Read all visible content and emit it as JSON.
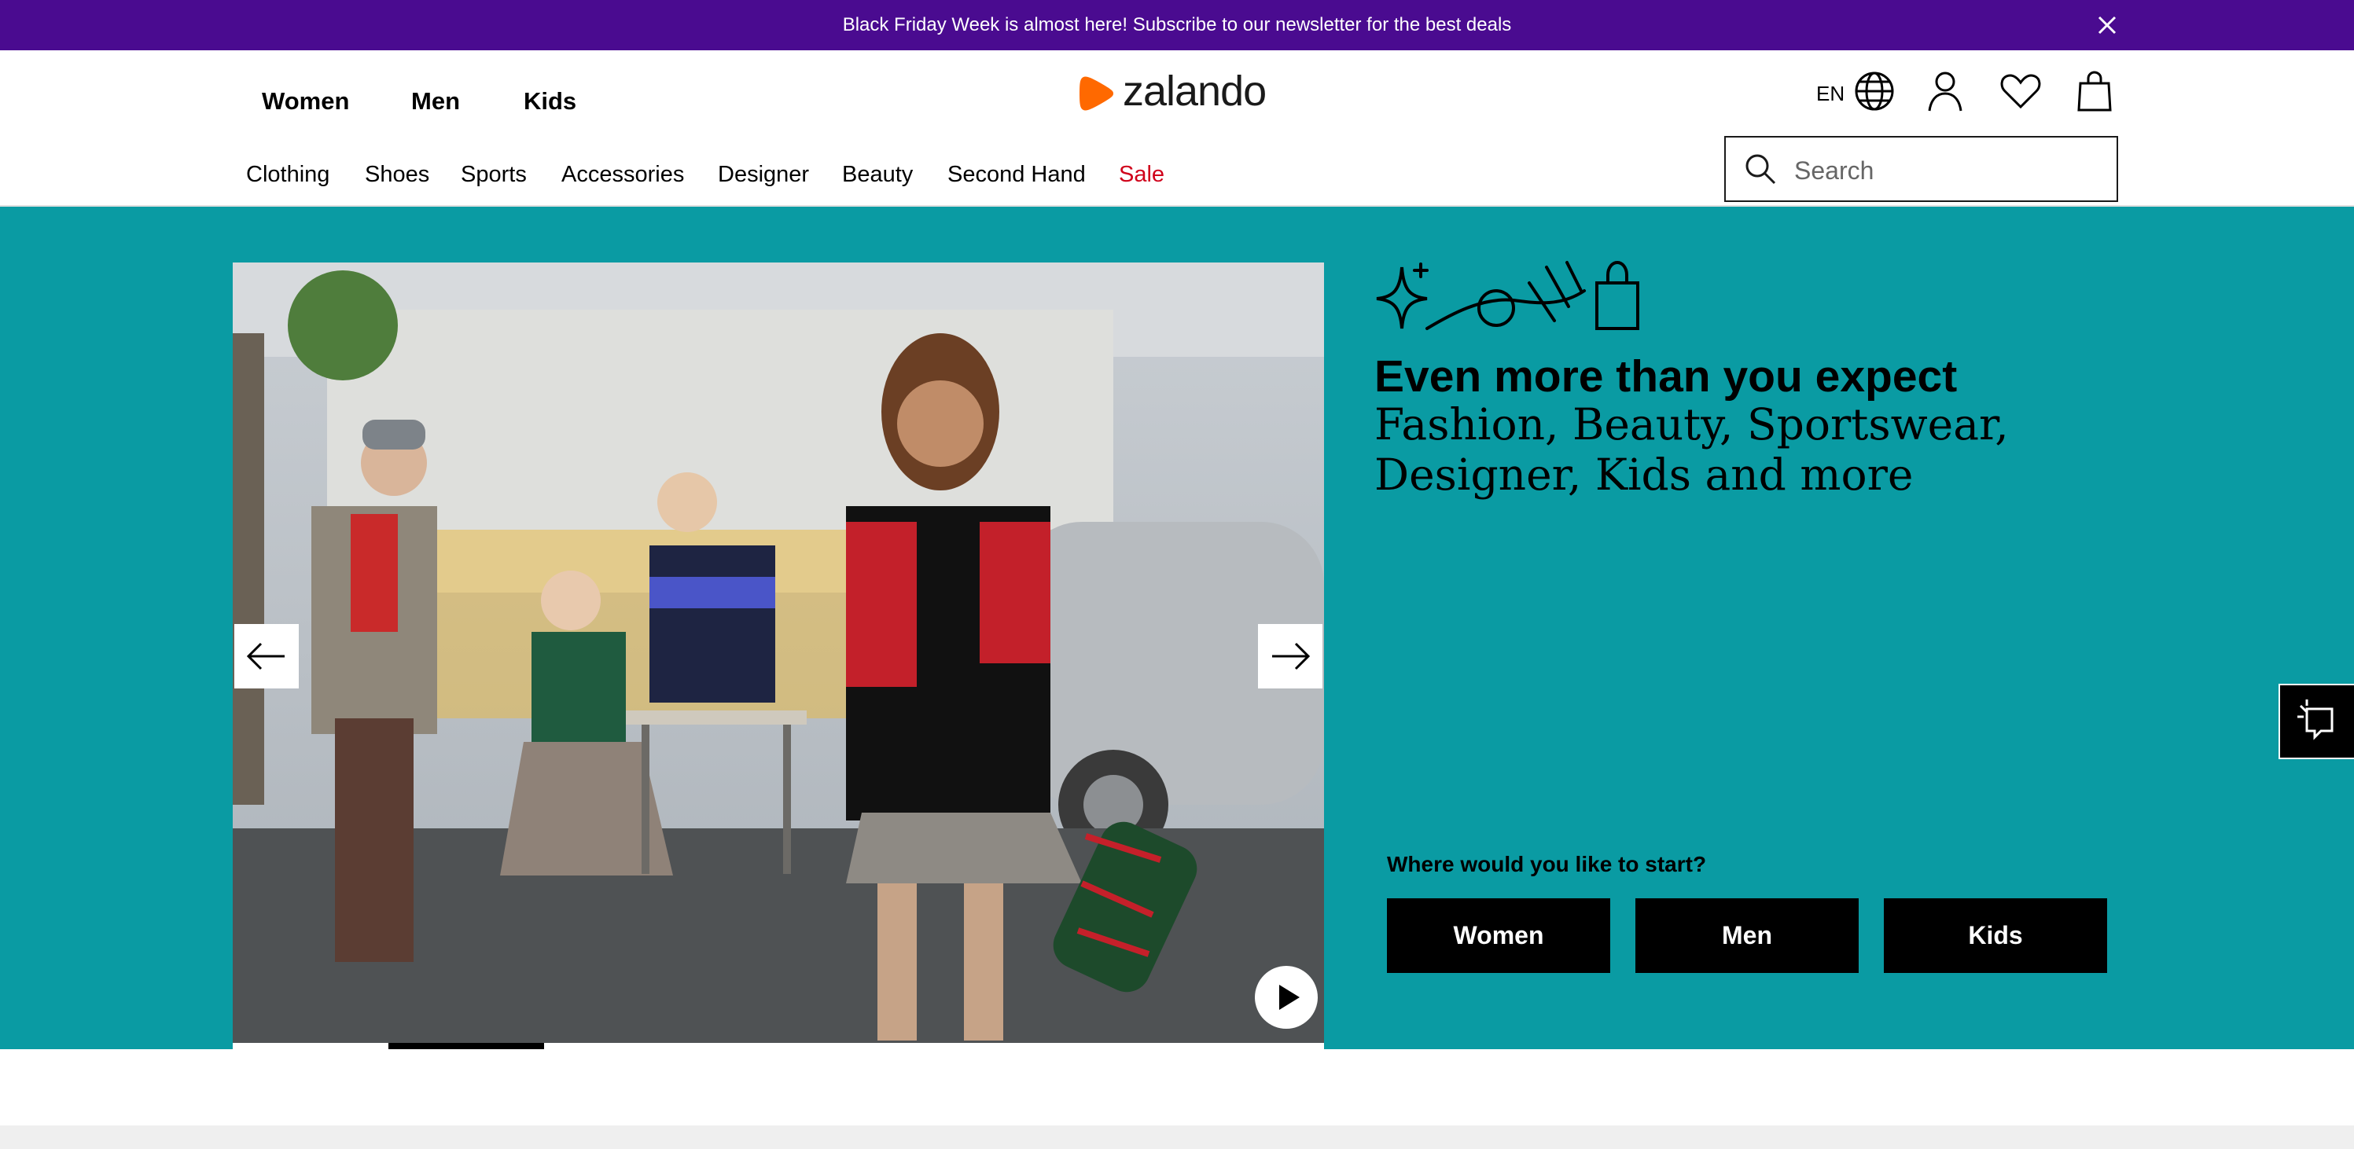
{
  "announcement": {
    "text": "Black Friday Week is almost here! Subscribe to our newsletter for the best deals",
    "close_icon": "close-icon"
  },
  "header": {
    "gender_tabs": [
      "Women",
      "Men",
      "Kids"
    ],
    "logo_text": "zalando",
    "language": "EN",
    "icons": [
      "globe-icon",
      "user-icon",
      "heart-icon",
      "bag-icon"
    ],
    "categories": [
      "Clothing",
      "Shoes",
      "Sports",
      "Accessories",
      "Designer",
      "Beauty",
      "Second Hand",
      "Sale"
    ],
    "search_placeholder": "Search"
  },
  "hero": {
    "heading": "Even more than you expect",
    "subheading": "Fashion, Beauty, Sportswear, Designer, Kids and more",
    "start_label": "Where would you like to start?",
    "start_buttons": [
      "Women",
      "Men",
      "Kids"
    ],
    "slider_progress": 0.143
  },
  "colors": {
    "announcement_bg": "#4a0b90",
    "hero_bg": "#0a9ba3",
    "brand_orange": "#ff6900",
    "sale_red": "#d0021b"
  }
}
